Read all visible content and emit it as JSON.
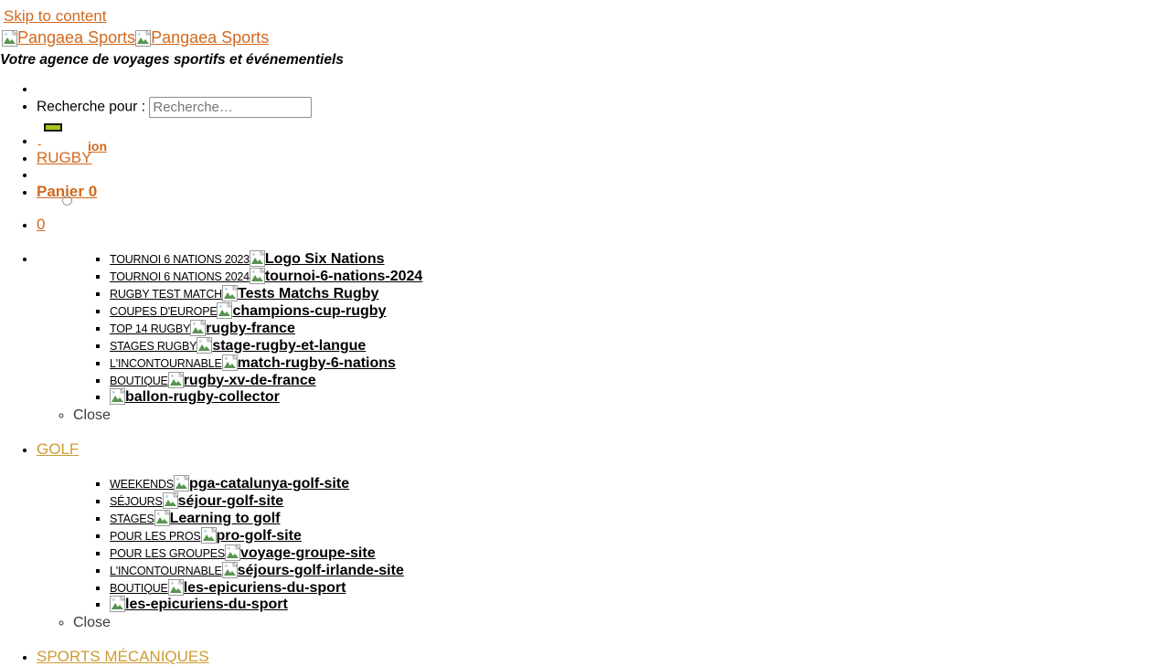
{
  "page": {
    "skip_link": "Skip to content",
    "brand_name": "Pangaea Sports",
    "brand_name_2": "Pangaea Sports",
    "tagline": "Votre agence de voyages sportifs et événementiels"
  },
  "search": {
    "label": "Recherche pour :",
    "placeholder": "Recherche…",
    "value": "",
    "submit_label": "",
    "button_color": "#a3c61c"
  },
  "colors": {
    "link_orange": "#d2691e",
    "link_gold": "#cd9b35",
    "text_black": "#000000",
    "close_gray": "#3b3b3b"
  },
  "nav": {
    "rugby_label": "RUGBY",
    "rugby_suffix": "ion",
    "dash": "-",
    "cart_label": "Panier 0",
    "cart_count": "0",
    "golf_label": "GOLF",
    "sports_meca_label": "SPORTS MÉCANIQUES",
    "close_label": "Close"
  },
  "rugby_menu": [
    {
      "label": "TOURNOI 6 NATIONS 2023",
      "img_alt": "Logo Six Nations",
      "size": "small"
    },
    {
      "label": "TOURNOI 6 NATIONS 2024",
      "img_alt": "tournoi-6-nations-2024",
      "size": "small"
    },
    {
      "label": "RUGBY TEST MATCH",
      "img_alt": "Tests Matchs Rugby",
      "size": "small"
    },
    {
      "label": "COUPES D'EUROPE",
      "img_alt": "champions-cup-rugby",
      "size": "small"
    },
    {
      "label": "TOP 14 RUGBY",
      "img_alt": "rugby-france",
      "size": "small"
    },
    {
      "label": "STAGES RUGBY",
      "img_alt": "stage-rugby-et-langue",
      "size": "small"
    },
    {
      "label": "L'INCONTOURNABLE",
      "img_alt": "match-rugby-6-nations",
      "size": "big"
    },
    {
      "label": "BOUTIQUE",
      "img_alt": "rugby-xv-de-france",
      "size": "big"
    },
    {
      "label": "",
      "img_alt": "ballon-rugby-collector",
      "size": "big"
    }
  ],
  "golf_menu": [
    {
      "label": "WEEKENDS",
      "img_alt": "pga-catalunya-golf-site",
      "size": "small"
    },
    {
      "label": "SÉJOURS",
      "img_alt": "séjour-golf-site",
      "size": "small"
    },
    {
      "label": "STAGES",
      "img_alt": "Learning to golf",
      "size": "small"
    },
    {
      "label": "POUR LES PROS",
      "img_alt": "pro-golf-site",
      "size": "small"
    },
    {
      "label": "POUR LES GROUPES",
      "img_alt": "voyage-groupe-site",
      "size": "small"
    },
    {
      "label": "L'INCONTOURNABLE",
      "img_alt": "séjours-golf-irlande-site",
      "size": "big"
    },
    {
      "label": "BOUTIQUE",
      "img_alt": "les-epicuriens-du-sport",
      "size": "big"
    },
    {
      "label": "",
      "img_alt": "les-epicuriens-du-sport",
      "size": "big"
    }
  ]
}
